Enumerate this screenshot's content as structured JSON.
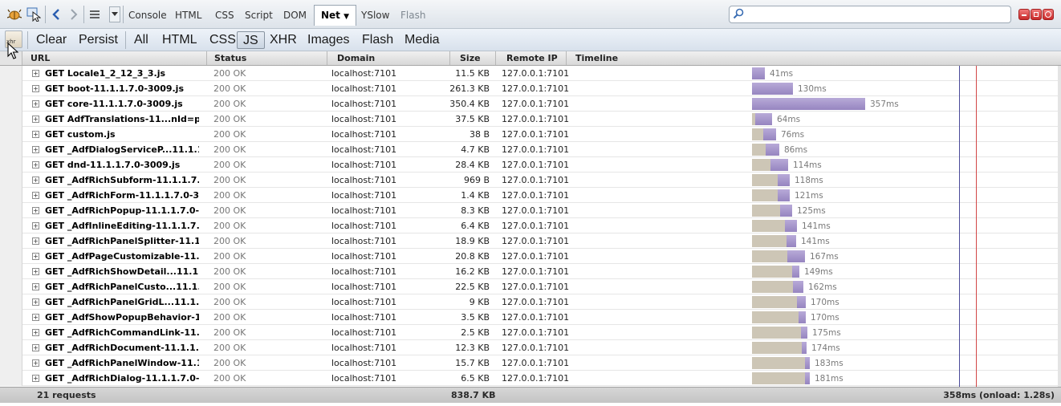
{
  "toolbar": {
    "tabs": [
      "Console",
      "HTML",
      "CSS",
      "Script",
      "DOM",
      "Net",
      "YSlow",
      "Flash"
    ],
    "active_tab": "Net",
    "search_placeholder": ""
  },
  "filters": {
    "actions": [
      "Clear",
      "Persist"
    ],
    "types": [
      "All",
      "HTML",
      "CSS",
      "JS",
      "XHR",
      "Images",
      "Flash",
      "Media"
    ],
    "active": "JS",
    "persist_icon_text": "xhr"
  },
  "columns": [
    "URL",
    "Status",
    "Domain",
    "Size",
    "Remote IP",
    "Timeline"
  ],
  "rows": [
    {
      "url": "GET Locale1_2_12_3_3.js",
      "status": "200 OK",
      "domain": "localhost:7101",
      "size": "11.5 KB",
      "ip": "127.0.0.1:7101",
      "wait_ms": 0,
      "recv_ms": 41,
      "time": "41ms"
    },
    {
      "url": "GET boot-11.1.1.7.0-3009.js",
      "status": "200 OK",
      "domain": "localhost:7101",
      "size": "261.3 KB",
      "ip": "127.0.0.1:7101",
      "wait_ms": 0,
      "recv_ms": 130,
      "time": "130ms"
    },
    {
      "url": "GET core-11.1.1.7.0-3009.js",
      "status": "200 OK",
      "domain": "localhost:7101",
      "size": "350.4 KB",
      "ip": "127.0.0.1:7101",
      "wait_ms": 0,
      "recv_ms": 357,
      "time": "357ms"
    },
    {
      "url": "GET AdfTranslations-11...nId=port",
      "status": "200 OK",
      "domain": "localhost:7101",
      "size": "37.5 KB",
      "ip": "127.0.0.1:7101",
      "wait_ms": 10,
      "recv_ms": 54,
      "time": "64ms"
    },
    {
      "url": "GET custom.js",
      "status": "200 OK",
      "domain": "localhost:7101",
      "size": "38 B",
      "ip": "127.0.0.1:7101",
      "wait_ms": 35,
      "recv_ms": 41,
      "time": "76ms"
    },
    {
      "url": "GET _AdfDialogServiceP...11.1.1.7.0",
      "status": "200 OK",
      "domain": "localhost:7101",
      "size": "4.7 KB",
      "ip": "127.0.0.1:7101",
      "wait_ms": 42,
      "recv_ms": 44,
      "time": "86ms"
    },
    {
      "url": "GET dnd-11.1.1.7.0-3009.js",
      "status": "200 OK",
      "domain": "localhost:7101",
      "size": "28.4 KB",
      "ip": "127.0.0.1:7101",
      "wait_ms": 58,
      "recv_ms": 56,
      "time": "114ms"
    },
    {
      "url": "GET _AdfRichSubform-11.1.1.7.0-3",
      "status": "200 OK",
      "domain": "localhost:7101",
      "size": "969 B",
      "ip": "127.0.0.1:7101",
      "wait_ms": 80,
      "recv_ms": 38,
      "time": "118ms"
    },
    {
      "url": "GET _AdfRichForm-11.1.1.7.0-3009",
      "status": "200 OK",
      "domain": "localhost:7101",
      "size": "1.4 KB",
      "ip": "127.0.0.1:7101",
      "wait_ms": 82,
      "recv_ms": 39,
      "time": "121ms"
    },
    {
      "url": "GET _AdfRichPopup-11.1.1.7.0-300",
      "status": "200 OK",
      "domain": "localhost:7101",
      "size": "8.3 KB",
      "ip": "127.0.0.1:7101",
      "wait_ms": 88,
      "recv_ms": 37,
      "time": "125ms"
    },
    {
      "url": "GET _AdfInlineEditing-11.1.1.7.0-3",
      "status": "200 OK",
      "domain": "localhost:7101",
      "size": "6.4 KB",
      "ip": "127.0.0.1:7101",
      "wait_ms": 104,
      "recv_ms": 37,
      "time": "141ms"
    },
    {
      "url": "GET _AdfRichPanelSplitter-11.1.1.7",
      "status": "200 OK",
      "domain": "localhost:7101",
      "size": "18.9 KB",
      "ip": "127.0.0.1:7101",
      "wait_ms": 110,
      "recv_ms": 31,
      "time": "141ms"
    },
    {
      "url": "GET _AdfPageCustomizable-11.1.1",
      "status": "200 OK",
      "domain": "localhost:7101",
      "size": "20.8 KB",
      "ip": "127.0.0.1:7101",
      "wait_ms": 112,
      "recv_ms": 55,
      "time": "167ms"
    },
    {
      "url": "GET _AdfRichShowDetail...11.1.1.7.",
      "status": "200 OK",
      "domain": "localhost:7101",
      "size": "16.2 KB",
      "ip": "127.0.0.1:7101",
      "wait_ms": 126,
      "recv_ms": 23,
      "time": "149ms"
    },
    {
      "url": "GET _AdfRichPanelCusto...11.1.1.7.",
      "status": "200 OK",
      "domain": "localhost:7101",
      "size": "22.5 KB",
      "ip": "127.0.0.1:7101",
      "wait_ms": 130,
      "recv_ms": 32,
      "time": "162ms"
    },
    {
      "url": "GET _AdfRichPanelGridL...11.1.1.7.0",
      "status": "200 OK",
      "domain": "localhost:7101",
      "size": "9 KB",
      "ip": "127.0.0.1:7101",
      "wait_ms": 142,
      "recv_ms": 28,
      "time": "170ms"
    },
    {
      "url": "GET _AdfShowPopupBehavior-11.1",
      "status": "200 OK",
      "domain": "localhost:7101",
      "size": "3.5 KB",
      "ip": "127.0.0.1:7101",
      "wait_ms": 146,
      "recv_ms": 24,
      "time": "170ms"
    },
    {
      "url": "GET _AdfRichCommandLink-11.1.1",
      "status": "200 OK",
      "domain": "localhost:7101",
      "size": "2.5 KB",
      "ip": "127.0.0.1:7101",
      "wait_ms": 155,
      "recv_ms": 20,
      "time": "175ms"
    },
    {
      "url": "GET _AdfRichDocument-11.1.1.7.0",
      "status": "200 OK",
      "domain": "localhost:7101",
      "size": "12.3 KB",
      "ip": "127.0.0.1:7101",
      "wait_ms": 158,
      "recv_ms": 16,
      "time": "174ms"
    },
    {
      "url": "GET _AdfRichPanelWindow-11.1.1.",
      "status": "200 OK",
      "domain": "localhost:7101",
      "size": "15.7 KB",
      "ip": "127.0.0.1:7101",
      "wait_ms": 168,
      "recv_ms": 15,
      "time": "183ms"
    },
    {
      "url": "GET _AdfRichDialog-11.1.1.7.0-300",
      "status": "200 OK",
      "domain": "localhost:7101",
      "size": "6.5 KB",
      "ip": "127.0.0.1:7101",
      "wait_ms": 166,
      "recv_ms": 15,
      "time": "181ms"
    }
  ],
  "summary": {
    "requests": "21 requests",
    "total_size": "838.7 KB",
    "total_time": "358ms (onload: 1.28s)"
  },
  "colors": {
    "wait": "#cdc6b6",
    "receive": "#a595cc",
    "domcontentloaded_line": "#4a4a9a",
    "load_line": "#d24646"
  },
  "timeline_markers_ms": {
    "domcontentloaded": 457,
    "load": 505
  }
}
